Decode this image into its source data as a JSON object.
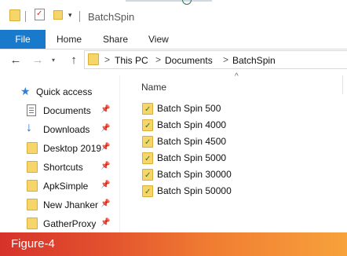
{
  "window": {
    "title": "BatchSpin"
  },
  "ribbon": {
    "file_tab": "File",
    "tabs": [
      "Home",
      "Share",
      "View"
    ]
  },
  "nav": {
    "back": "←",
    "forward": "→",
    "up": "↑"
  },
  "address": {
    "crumbs": [
      "This PC",
      "Documents",
      "BatchSpin"
    ],
    "separator": ">"
  },
  "sidebar": {
    "quick_access": "Quick access",
    "items": [
      {
        "label": "Documents",
        "icon": "documents-icon",
        "pinned": true
      },
      {
        "label": "Downloads",
        "icon": "downloads-icon",
        "pinned": true
      },
      {
        "label": "Desktop 2019",
        "icon": "folder-icon",
        "pinned": true
      },
      {
        "label": "Shortcuts",
        "icon": "folder-icon",
        "pinned": true
      },
      {
        "label": "ApkSimple",
        "icon": "folder-icon",
        "pinned": true
      },
      {
        "label": "New Jhanker",
        "icon": "folder-icon",
        "pinned": true
      },
      {
        "label": "GatherProxy",
        "icon": "folder-icon",
        "pinned": true
      }
    ],
    "pin_glyph": "📌"
  },
  "content": {
    "column_name": "Name",
    "sort_glyph": "^",
    "files": [
      {
        "name": "Batch Spin 500"
      },
      {
        "name": "Batch Spin 4000"
      },
      {
        "name": "Batch Spin 4500"
      },
      {
        "name": "Batch Spin 5000"
      },
      {
        "name": "Batch Spin 30000"
      },
      {
        "name": "Batch Spin 50000"
      }
    ]
  },
  "footer": {
    "label": "Figure-4"
  },
  "colors": {
    "file_tab": "#1979ca",
    "folder": "#f6d56b",
    "footer_start": "#d7322a",
    "footer_end": "#f7a23b"
  }
}
